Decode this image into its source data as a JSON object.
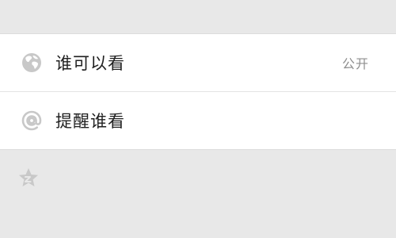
{
  "colors": {
    "background": "#e8e8e8",
    "panel": "#ffffff",
    "icon": "#c8c8c8",
    "label": "#1f1f1f",
    "value": "#8f8f8f"
  },
  "settings": {
    "visibility": {
      "icon": "globe-icon",
      "label": "谁可以看",
      "value": "公开"
    },
    "remind": {
      "icon": "at-sign-icon",
      "label": "提醒谁看"
    }
  },
  "footer": {
    "icon": "star-icon"
  }
}
